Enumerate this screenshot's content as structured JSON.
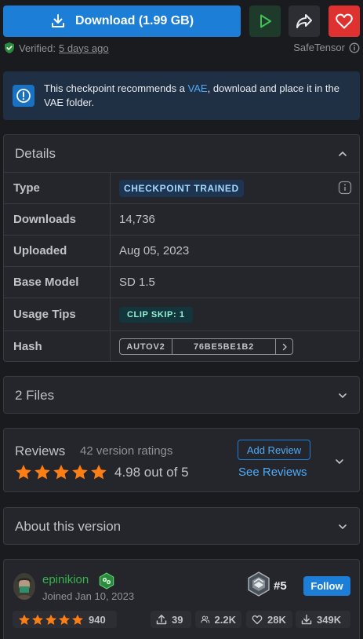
{
  "download": {
    "label": "Download (1.99 GB)"
  },
  "verified": {
    "label": "Verified:",
    "date": "5 days ago",
    "format": "SafeTensor"
  },
  "alert": {
    "text_before": "This checkpoint recommends a ",
    "link": "VAE",
    "text_after": ", download and place it in the VAE folder."
  },
  "details": {
    "title": "Details",
    "rows": [
      {
        "label": "Type",
        "value": "CHECKPOINT TRAINED"
      },
      {
        "label": "Downloads",
        "value": "14,736"
      },
      {
        "label": "Uploaded",
        "value": "Aug 05, 2023"
      },
      {
        "label": "Base Model",
        "value": "SD 1.5"
      },
      {
        "label": "Usage Tips",
        "value": "CLIP SKIP: 1"
      },
      {
        "label": "Hash",
        "hash_type": "AUTOV2",
        "hash_value": "76BE5BE1B2"
      }
    ]
  },
  "files": {
    "title": "2 Files"
  },
  "reviews": {
    "title": "Reviews",
    "count": "42 version ratings",
    "score": "4.98 out of 5",
    "stars": 5,
    "add_review": "Add Review",
    "see_reviews": "See Reviews"
  },
  "about": {
    "title": "About this version"
  },
  "creator": {
    "name": "epinikion",
    "joined": "Joined Jan 10, 2023",
    "rank": "#5",
    "follow": "Follow",
    "rating_count": "940",
    "uploads": "39",
    "followers": "2.2K",
    "likes": "28K",
    "downloads": "349K"
  },
  "colors": {
    "accent": "#1c7ed6",
    "star": "#fd7e14",
    "like": "#e03131",
    "play": "#40c057",
    "username": "#37b24d"
  }
}
